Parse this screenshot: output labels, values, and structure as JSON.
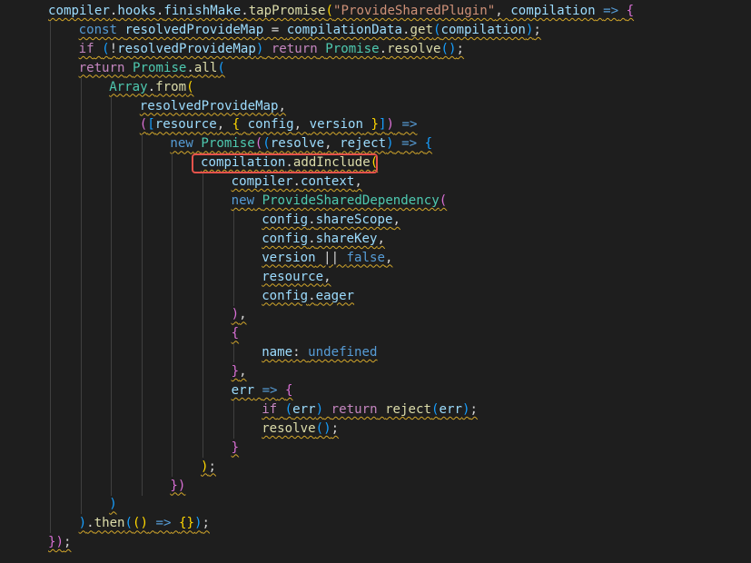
{
  "editor": {
    "language": "javascript",
    "highlight_color": "#e5534b",
    "squiggle_color": "#d4a82b",
    "lines": [
      {
        "indent": 0,
        "tokens": [
          {
            "t": "compiler",
            "c": "var"
          },
          {
            "t": ".",
            "c": "op"
          },
          {
            "t": "hooks",
            "c": "var"
          },
          {
            "t": ".",
            "c": "op"
          },
          {
            "t": "finishMake",
            "c": "var"
          },
          {
            "t": ".",
            "c": "op"
          },
          {
            "t": "tapPromise",
            "c": "fn"
          },
          {
            "t": "(",
            "c": "br1"
          },
          {
            "t": "\"ProvideSharedPlugin\"",
            "c": "str"
          },
          {
            "t": ", ",
            "c": "op"
          },
          {
            "t": "compilation",
            "c": "var"
          },
          {
            "t": " ",
            "c": "op"
          },
          {
            "t": "=>",
            "c": "kw"
          },
          {
            "t": " ",
            "c": "op"
          },
          {
            "t": "{",
            "c": "br2"
          }
        ]
      },
      {
        "indent": 1,
        "tokens": [
          {
            "t": "const",
            "c": "kw"
          },
          {
            "t": " ",
            "c": "op"
          },
          {
            "t": "resolvedProvideMap",
            "c": "var"
          },
          {
            "t": " = ",
            "c": "op"
          },
          {
            "t": "compilationData",
            "c": "var"
          },
          {
            "t": ".",
            "c": "op"
          },
          {
            "t": "get",
            "c": "fn"
          },
          {
            "t": "(",
            "c": "br3"
          },
          {
            "t": "compilation",
            "c": "var"
          },
          {
            "t": ")",
            "c": "br3"
          },
          {
            "t": ";",
            "c": "op"
          }
        ]
      },
      {
        "indent": 1,
        "tokens": [
          {
            "t": "if",
            "c": "ctl"
          },
          {
            "t": " ",
            "c": "op"
          },
          {
            "t": "(",
            "c": "br3"
          },
          {
            "t": "!",
            "c": "op"
          },
          {
            "t": "resolvedProvideMap",
            "c": "var"
          },
          {
            "t": ")",
            "c": "br3"
          },
          {
            "t": " ",
            "c": "op"
          },
          {
            "t": "return",
            "c": "ctl"
          },
          {
            "t": " ",
            "c": "op"
          },
          {
            "t": "Promise",
            "c": "cls"
          },
          {
            "t": ".",
            "c": "op"
          },
          {
            "t": "resolve",
            "c": "fn"
          },
          {
            "t": "()",
            "c": "br3"
          },
          {
            "t": ";",
            "c": "op"
          }
        ]
      },
      {
        "indent": 1,
        "tokens": [
          {
            "t": "return",
            "c": "ctl"
          },
          {
            "t": " ",
            "c": "op"
          },
          {
            "t": "Promise",
            "c": "cls"
          },
          {
            "t": ".",
            "c": "op"
          },
          {
            "t": "all",
            "c": "fn"
          },
          {
            "t": "(",
            "c": "br3"
          }
        ]
      },
      {
        "indent": 2,
        "tokens": [
          {
            "t": "Array",
            "c": "cls"
          },
          {
            "t": ".",
            "c": "op"
          },
          {
            "t": "from",
            "c": "fn"
          },
          {
            "t": "(",
            "c": "br1"
          }
        ]
      },
      {
        "indent": 3,
        "tokens": [
          {
            "t": "resolvedProvideMap",
            "c": "var"
          },
          {
            "t": ",",
            "c": "op"
          }
        ]
      },
      {
        "indent": 3,
        "tokens": [
          {
            "t": "(",
            "c": "br2"
          },
          {
            "t": "[",
            "c": "br3"
          },
          {
            "t": "resource",
            "c": "var"
          },
          {
            "t": ", ",
            "c": "op"
          },
          {
            "t": "{",
            "c": "br1"
          },
          {
            "t": " ",
            "c": "op"
          },
          {
            "t": "config",
            "c": "var"
          },
          {
            "t": ", ",
            "c": "op"
          },
          {
            "t": "version",
            "c": "var"
          },
          {
            "t": " ",
            "c": "op"
          },
          {
            "t": "}",
            "c": "br1"
          },
          {
            "t": "]",
            "c": "br3"
          },
          {
            "t": ")",
            "c": "br2"
          },
          {
            "t": " ",
            "c": "op"
          },
          {
            "t": "=>",
            "c": "kw"
          }
        ]
      },
      {
        "indent": 4,
        "tokens": [
          {
            "t": "new",
            "c": "kw"
          },
          {
            "t": " ",
            "c": "op"
          },
          {
            "t": "Promise",
            "c": "cls"
          },
          {
            "t": "(",
            "c": "br2"
          },
          {
            "t": "(",
            "c": "br3"
          },
          {
            "t": "resolve",
            "c": "var"
          },
          {
            "t": ", ",
            "c": "op"
          },
          {
            "t": "reject",
            "c": "var"
          },
          {
            "t": ")",
            "c": "br3"
          },
          {
            "t": " ",
            "c": "op"
          },
          {
            "t": "=>",
            "c": "kw"
          },
          {
            "t": " ",
            "c": "op"
          },
          {
            "t": "{",
            "c": "br3"
          }
        ]
      },
      {
        "indent": 5,
        "highlight": true,
        "tokens": [
          {
            "t": "compilation",
            "c": "var"
          },
          {
            "t": ".",
            "c": "op"
          },
          {
            "t": "addInclude",
            "c": "fn"
          },
          {
            "t": "(",
            "c": "br1"
          }
        ]
      },
      {
        "indent": 6,
        "tokens": [
          {
            "t": "compiler",
            "c": "var"
          },
          {
            "t": ".",
            "c": "op"
          },
          {
            "t": "context",
            "c": "var"
          },
          {
            "t": ",",
            "c": "op"
          }
        ]
      },
      {
        "indent": 6,
        "tokens": [
          {
            "t": "new",
            "c": "kw"
          },
          {
            "t": " ",
            "c": "op"
          },
          {
            "t": "ProvideSharedDependency",
            "c": "cls"
          },
          {
            "t": "(",
            "c": "br2"
          }
        ]
      },
      {
        "indent": 7,
        "tokens": [
          {
            "t": "config",
            "c": "var"
          },
          {
            "t": ".",
            "c": "op"
          },
          {
            "t": "shareScope",
            "c": "var"
          },
          {
            "t": ",",
            "c": "op"
          }
        ]
      },
      {
        "indent": 7,
        "tokens": [
          {
            "t": "config",
            "c": "var"
          },
          {
            "t": ".",
            "c": "op"
          },
          {
            "t": "shareKey",
            "c": "var"
          },
          {
            "t": ",",
            "c": "op"
          }
        ]
      },
      {
        "indent": 7,
        "tokens": [
          {
            "t": "version",
            "c": "var"
          },
          {
            "t": " || ",
            "c": "op"
          },
          {
            "t": "false",
            "c": "kw"
          },
          {
            "t": ",",
            "c": "op"
          }
        ]
      },
      {
        "indent": 7,
        "tokens": [
          {
            "t": "resource",
            "c": "var"
          },
          {
            "t": ",",
            "c": "op"
          }
        ]
      },
      {
        "indent": 7,
        "tokens": [
          {
            "t": "config",
            "c": "var"
          },
          {
            "t": ".",
            "c": "op"
          },
          {
            "t": "eager",
            "c": "var"
          }
        ]
      },
      {
        "indent": 6,
        "tokens": [
          {
            "t": ")",
            "c": "br2"
          },
          {
            "t": ",",
            "c": "op"
          }
        ]
      },
      {
        "indent": 6,
        "tokens": [
          {
            "t": "{",
            "c": "br2"
          }
        ]
      },
      {
        "indent": 7,
        "tokens": [
          {
            "t": "name",
            "c": "var"
          },
          {
            "t": ": ",
            "c": "op"
          },
          {
            "t": "undefined",
            "c": "kw"
          }
        ]
      },
      {
        "indent": 6,
        "tokens": [
          {
            "t": "}",
            "c": "br2"
          },
          {
            "t": ",",
            "c": "op"
          }
        ]
      },
      {
        "indent": 6,
        "tokens": [
          {
            "t": "err",
            "c": "var"
          },
          {
            "t": " ",
            "c": "op"
          },
          {
            "t": "=>",
            "c": "kw"
          },
          {
            "t": " ",
            "c": "op"
          },
          {
            "t": "{",
            "c": "br2"
          }
        ]
      },
      {
        "indent": 7,
        "tokens": [
          {
            "t": "if",
            "c": "ctl"
          },
          {
            "t": " ",
            "c": "op"
          },
          {
            "t": "(",
            "c": "br3"
          },
          {
            "t": "err",
            "c": "var"
          },
          {
            "t": ")",
            "c": "br3"
          },
          {
            "t": " ",
            "c": "op"
          },
          {
            "t": "return",
            "c": "ctl"
          },
          {
            "t": " ",
            "c": "op"
          },
          {
            "t": "reject",
            "c": "fn"
          },
          {
            "t": "(",
            "c": "br3"
          },
          {
            "t": "err",
            "c": "var"
          },
          {
            "t": ")",
            "c": "br3"
          },
          {
            "t": ";",
            "c": "op"
          }
        ]
      },
      {
        "indent": 7,
        "tokens": [
          {
            "t": "resolve",
            "c": "fn"
          },
          {
            "t": "()",
            "c": "br3"
          },
          {
            "t": ";",
            "c": "op"
          }
        ]
      },
      {
        "indent": 6,
        "tokens": [
          {
            "t": "}",
            "c": "br2"
          }
        ]
      },
      {
        "indent": 5,
        "tokens": [
          {
            "t": ")",
            "c": "br1"
          },
          {
            "t": ";",
            "c": "op"
          }
        ]
      },
      {
        "indent": 4,
        "tokens": [
          {
            "t": "})",
            "c": "br2"
          }
        ]
      },
      {
        "indent": 2,
        "tokens": [
          {
            "t": ")",
            "c": "br3"
          }
        ]
      },
      {
        "indent": 1,
        "tokens": [
          {
            "t": ")",
            "c": "br3"
          },
          {
            "t": ".",
            "c": "op"
          },
          {
            "t": "then",
            "c": "fn"
          },
          {
            "t": "(",
            "c": "br3"
          },
          {
            "t": "()",
            "c": "br1"
          },
          {
            "t": " ",
            "c": "op"
          },
          {
            "t": "=>",
            "c": "kw"
          },
          {
            "t": " ",
            "c": "op"
          },
          {
            "t": "{}",
            "c": "br1"
          },
          {
            "t": ")",
            "c": "br3"
          },
          {
            "t": ";",
            "c": "op"
          }
        ]
      },
      {
        "indent": 0,
        "tokens": [
          {
            "t": "})",
            "c": "br2"
          },
          {
            "t": ";",
            "c": "op"
          }
        ]
      }
    ]
  }
}
